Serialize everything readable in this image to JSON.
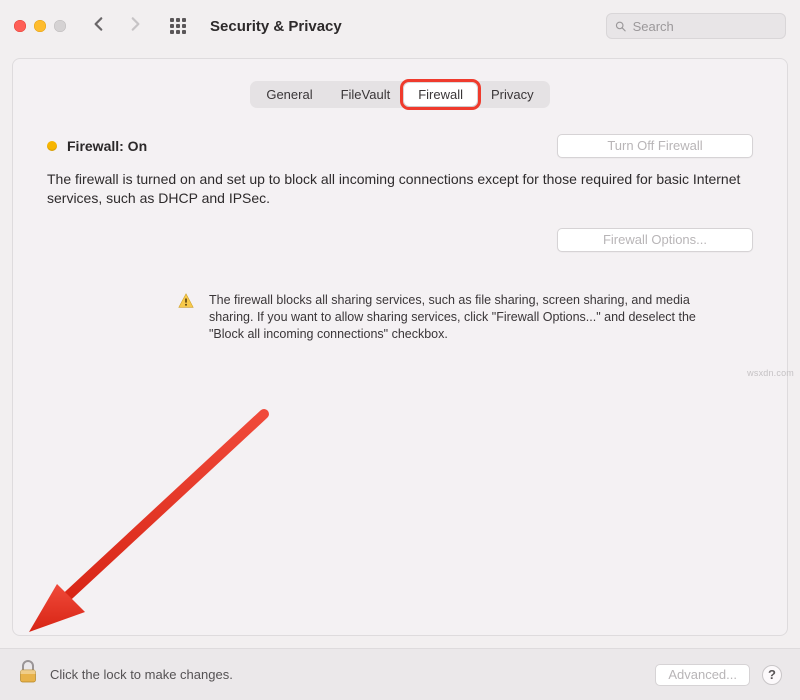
{
  "header": {
    "title": "Security & Privacy",
    "search_placeholder": "Search"
  },
  "tabs": [
    {
      "label": "General"
    },
    {
      "label": "FileVault"
    },
    {
      "label": "Firewall",
      "selected": true,
      "highlighted": true
    },
    {
      "label": "Privacy"
    }
  ],
  "firewall": {
    "status_label": "Firewall: On",
    "toggle_button": "Turn Off Firewall",
    "description": "The firewall is turned on and set up to block all incoming connections except for those required for basic Internet services, such as DHCP and IPSec.",
    "options_button": "Firewall Options...",
    "note": "The firewall blocks all sharing services, such as file sharing, screen sharing, and media sharing. If you want to allow sharing services, click \"Firewall Options...\" and deselect the \"Block all incoming connections\" checkbox."
  },
  "footer": {
    "lock_text": "Click the lock to make changes.",
    "advanced_button": "Advanced...",
    "help_label": "?"
  },
  "watermark": "wsxdn.com",
  "colors": {
    "highlight": "#ef3b2d",
    "status_dot": "#f7b500"
  }
}
